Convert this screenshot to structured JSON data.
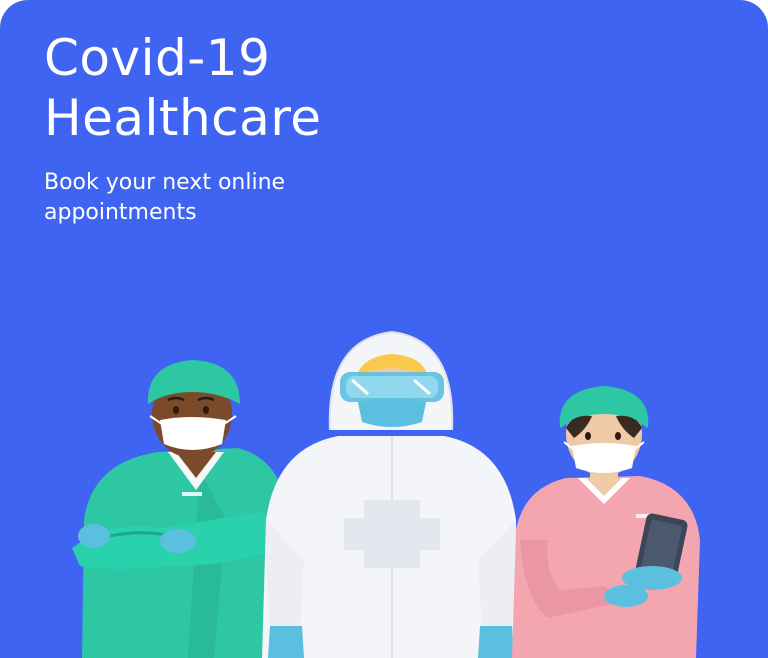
{
  "card": {
    "background_color": "#4064f2",
    "title_lines": [
      "Covid-19",
      "Healthcare"
    ],
    "subtitle_lines": [
      "Book your next online",
      "appointments"
    ]
  },
  "illustration": {
    "figures": [
      "doctor-in-scrubs",
      "hazmat-suit-worker",
      "nurse-with-tablet"
    ],
    "colors": {
      "scrubs": "#2dc7a3",
      "hazmat": "#f4f5f8",
      "nurse_uniform": "#f3a6b0",
      "gloves": "#5bc0e0"
    }
  }
}
